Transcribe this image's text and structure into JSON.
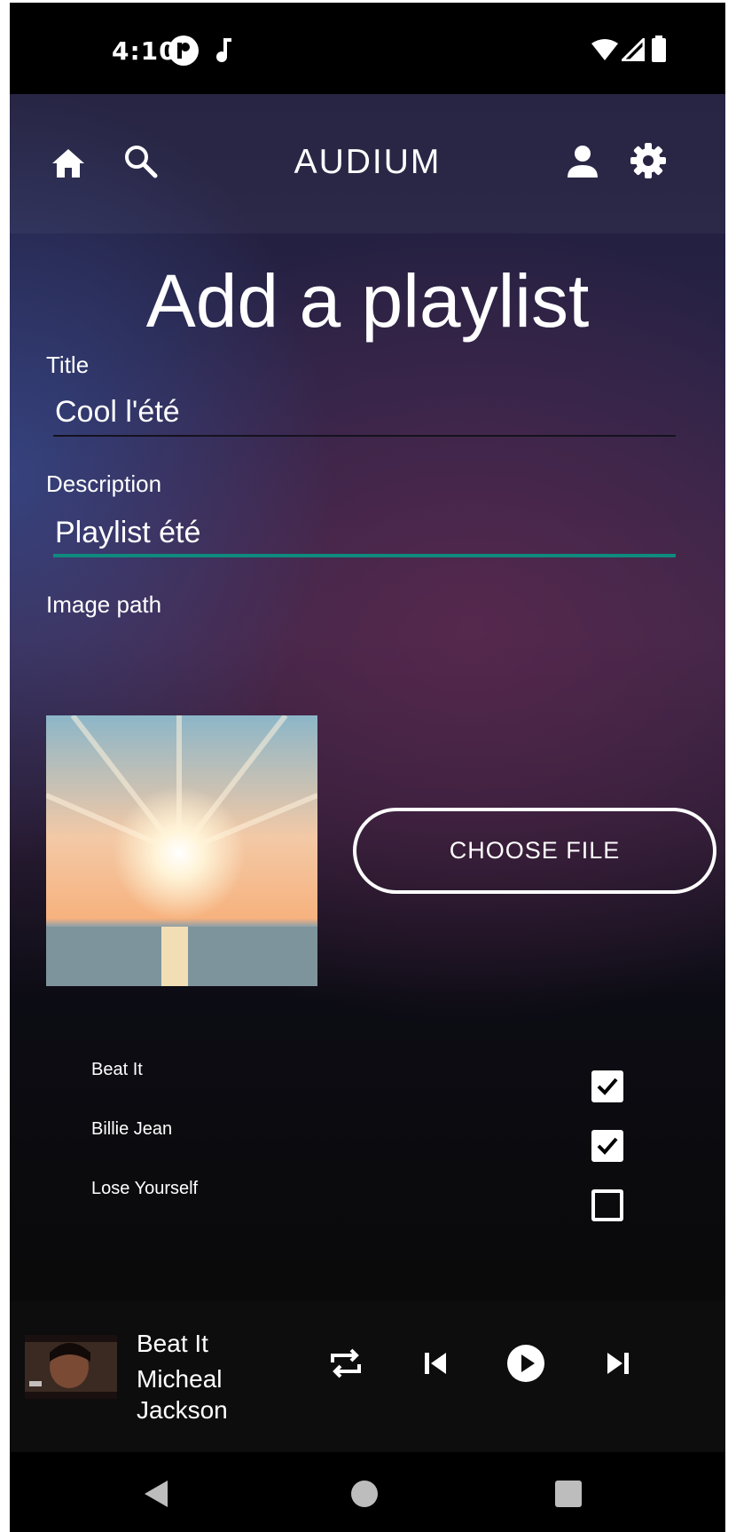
{
  "status_bar": {
    "time": "4:10",
    "icons": [
      "app-notification-icon",
      "music-note-icon",
      "wifi-icon",
      "signal-icon",
      "battery-icon"
    ]
  },
  "top_bar": {
    "title": "AUDIUM",
    "icons": [
      "home-icon",
      "search-icon",
      "account-icon",
      "settings-icon"
    ]
  },
  "form": {
    "heading": "Add a playlist",
    "title_label": "Title",
    "title_value": "Cool l'été",
    "description_label": "Description",
    "description_value": "Playlist été",
    "image_label": "Image path",
    "choose_file_label": "CHOOSE FILE",
    "accent_color": "#0f8a7e"
  },
  "tracks": [
    {
      "name": "Beat It",
      "checked": true
    },
    {
      "name": "Billie Jean",
      "checked": true
    },
    {
      "name": "Lose Yourself",
      "checked": false
    }
  ],
  "player": {
    "track_title": "Beat It",
    "artist_line1": "Micheal",
    "artist_line2": "Jackson",
    "controls": [
      "repeat-icon",
      "skip-previous-icon",
      "play-icon",
      "skip-next-icon"
    ]
  },
  "nav_bar": {
    "buttons": [
      "back-icon",
      "home-circle-icon",
      "recents-icon"
    ]
  }
}
